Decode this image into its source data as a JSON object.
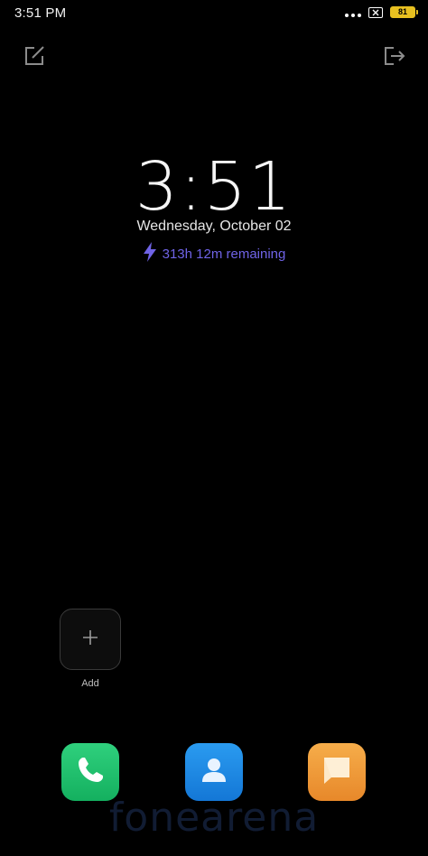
{
  "status_bar": {
    "time": "3:51 PM",
    "battery_level": "81",
    "icons": [
      "more-dots-icon",
      "sim-disabled-icon",
      "battery-icon"
    ]
  },
  "top_actions": {
    "left_icon": "edit-icon",
    "right_icon": "exit-icon"
  },
  "clock": {
    "time": "3:51",
    "date": "Wednesday, October 02",
    "battery_remaining": "313h 12m remaining",
    "battery_icon": "lightning-bolt-icon"
  },
  "shortcut": {
    "add_label": "Add",
    "add_icon": "plus-icon"
  },
  "dock": {
    "apps": [
      {
        "name": "phone",
        "icon": "phone-icon",
        "color": "#1cc06a"
      },
      {
        "name": "contacts",
        "icon": "contacts-icon",
        "color": "#1e88e5"
      },
      {
        "name": "messages",
        "icon": "message-icon",
        "color": "#f09a3a"
      }
    ]
  },
  "watermark": {
    "text": "fonearena"
  },
  "colors": {
    "background": "#000000",
    "accent_purple": "#6f63e6",
    "battery_yellow": "#e8c020"
  }
}
